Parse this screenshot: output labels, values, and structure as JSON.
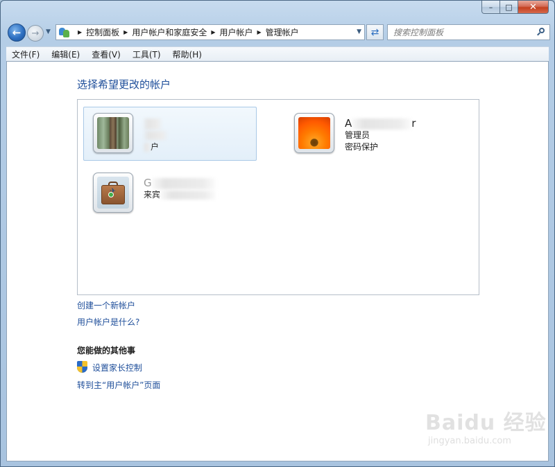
{
  "window": {
    "minimize_glyph": "–",
    "maximize_glyph": "□",
    "close_glyph": "✕"
  },
  "nav": {
    "back_glyph": "←",
    "forward_glyph": "→",
    "history_glyph": "▼"
  },
  "address": {
    "crumbs": [
      "控制面板",
      "用户帐户和家庭安全",
      "用户帐户",
      "管理帐户"
    ],
    "sep": "▶",
    "dropdown_glyph": "▼"
  },
  "refresh_glyph": "⇄",
  "search": {
    "placeholder": "搜索控制面板"
  },
  "menu": {
    "items": [
      "文件(F)",
      "编辑(E)",
      "查看(V)",
      "工具(T)",
      "帮助(H)"
    ]
  },
  "main": {
    "heading": "选择希望更改的帐户",
    "accounts": [
      {
        "name": "",
        "line1": "",
        "line2": "户",
        "picture": "forest",
        "selected": true
      },
      {
        "name": "A",
        "name_suffix": "r",
        "line1": "管理员",
        "line2": "密码保护",
        "picture": "flower",
        "selected": false
      },
      {
        "name": "G",
        "line1": "来宾",
        "line2": "",
        "picture": "briefcase",
        "selected": false
      }
    ],
    "links": {
      "create_account": "创建一个新帐户",
      "what_is_account": "用户帐户是什么?"
    },
    "other_title": "您能做的其他事",
    "other_links": {
      "parental_controls": "设置家长控制",
      "goto_main": "转到主“用户帐户”页面"
    }
  },
  "watermark": {
    "logo": "Baidu 经验",
    "sub": "jingyan.baidu.com"
  }
}
